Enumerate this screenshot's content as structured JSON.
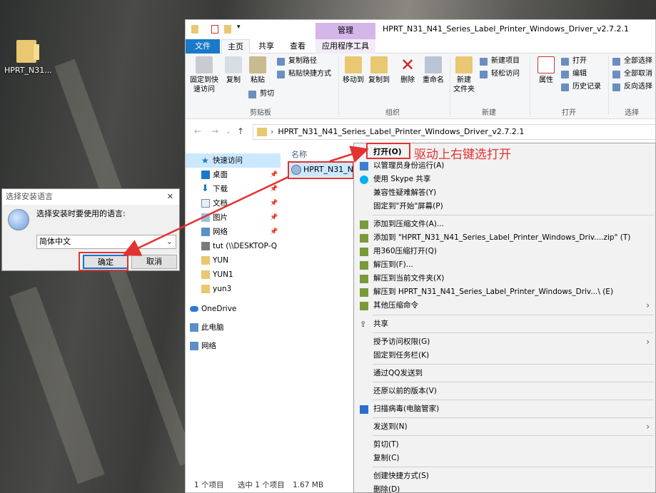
{
  "desktop": {
    "icon_label": "HPRT_N31..."
  },
  "lang_dialog": {
    "title": "选择安装语言",
    "prompt": "选择安装时要使用的语言:",
    "selected": "简体中文",
    "ok": "确定",
    "cancel": "取消"
  },
  "explorer": {
    "title": "HPRT_N31_N41_Series_Label_Printer_Windows_Driver_v2.7.2.1",
    "manage_tab": "管理",
    "tabs": {
      "file": "文件",
      "home": "主页",
      "share": "共享",
      "view": "查看",
      "app_tools": "应用程序工具"
    },
    "ribbon": {
      "pin": "固定到快\n速访问",
      "copy": "复制",
      "paste": "粘贴",
      "copy_path": "复制路径",
      "paste_shortcut": "粘贴快捷方式",
      "cut": "剪切",
      "clipboard": "剪贴板",
      "move_to": "移动到",
      "copy_to": "复制到",
      "delete": "删除",
      "rename": "重命名",
      "organize": "组织",
      "new_folder": "新建\n文件夹",
      "new_item": "新建项目",
      "easy_access": "轻松访问",
      "new": "新建",
      "properties": "属性",
      "open": "打开",
      "edit": "编辑",
      "history": "历史记录",
      "open_group": "打开",
      "select_all": "全部选择",
      "select_none": "全部取消",
      "invert": "反向选择",
      "select_group": "选择"
    },
    "address": "HPRT_N31_N41_Series_Label_Printer_Windows_Driver_v2.7.2.1",
    "nav": {
      "quick_access": "快速访问",
      "items": [
        "桌面",
        "下载",
        "文档",
        "图片",
        "网络",
        "tut (\\\\DESKTOP-Q",
        "YUN",
        "YUN1",
        "yun3"
      ],
      "onedrive": "OneDrive",
      "this_pc": "此电脑",
      "network": "网络"
    },
    "column_name": "名称",
    "file_name": "HPRT_N31_N4",
    "status": {
      "count": "1 个项目",
      "selected": "选中 1 个项目",
      "size": "1.67 MB"
    }
  },
  "context_menu": {
    "items": [
      "打开(O)",
      "以管理员身份运行(A)",
      "使用 Skype 共享",
      "兼容性疑难解答(Y)",
      "固定到\"开始\"屏幕(P)",
      "添加到压缩文件(A)...",
      "添加到 \"HPRT_N31_N41_Series_Label_Printer_Windows_Driv....zip\" (T)",
      "用360压缩打开(Q)",
      "解压到(F)...",
      "解压到当前文件夹(X)",
      "解压到 HPRT_N31_N41_Series_Label_Printer_Windows_Driv...\\ (E)",
      "其他压缩命令",
      "共享",
      "授予访问权限(G)",
      "固定到任务栏(K)",
      "通过QQ发送到",
      "还原以前的版本(V)",
      "扫描病毒(电脑管家)",
      "发送到(N)",
      "剪切(T)",
      "复制(C)",
      "创建快捷方式(S)",
      "删除(D)"
    ]
  },
  "annotation": "驱动上右键选打开",
  "colors": {
    "accent": "#1979ca",
    "highlight": "#e23232",
    "selection": "#cce8ff"
  }
}
